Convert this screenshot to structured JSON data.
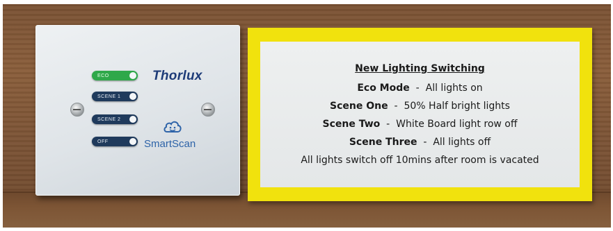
{
  "switch_plate": {
    "brand": "Thorlux",
    "product": "SmartScan",
    "switches": [
      {
        "label": "ECO",
        "active": true
      },
      {
        "label": "SCENE 1",
        "active": false
      },
      {
        "label": "SCENE 2",
        "active": false
      },
      {
        "label": "OFF",
        "active": false
      }
    ]
  },
  "sign": {
    "title": "New Lighting Switching",
    "rows": [
      {
        "name": "Eco Mode",
        "sep": "-",
        "desc": "All lights on"
      },
      {
        "name": "Scene One",
        "sep": "-",
        "desc": "50% Half bright lights"
      },
      {
        "name": "Scene Two",
        "sep": "-",
        "desc": "White Board light row off"
      },
      {
        "name": "Scene Three",
        "sep": "-",
        "desc": "All lights off"
      }
    ],
    "footer": "All lights switch off 10mins after room is vacated"
  },
  "colors": {
    "wood": "#7a5234",
    "sign_border": "#f1e20d",
    "switch_active": "#2fa84a",
    "switch_inactive": "#1f3a5c",
    "brand_text": "#1d3b78"
  }
}
